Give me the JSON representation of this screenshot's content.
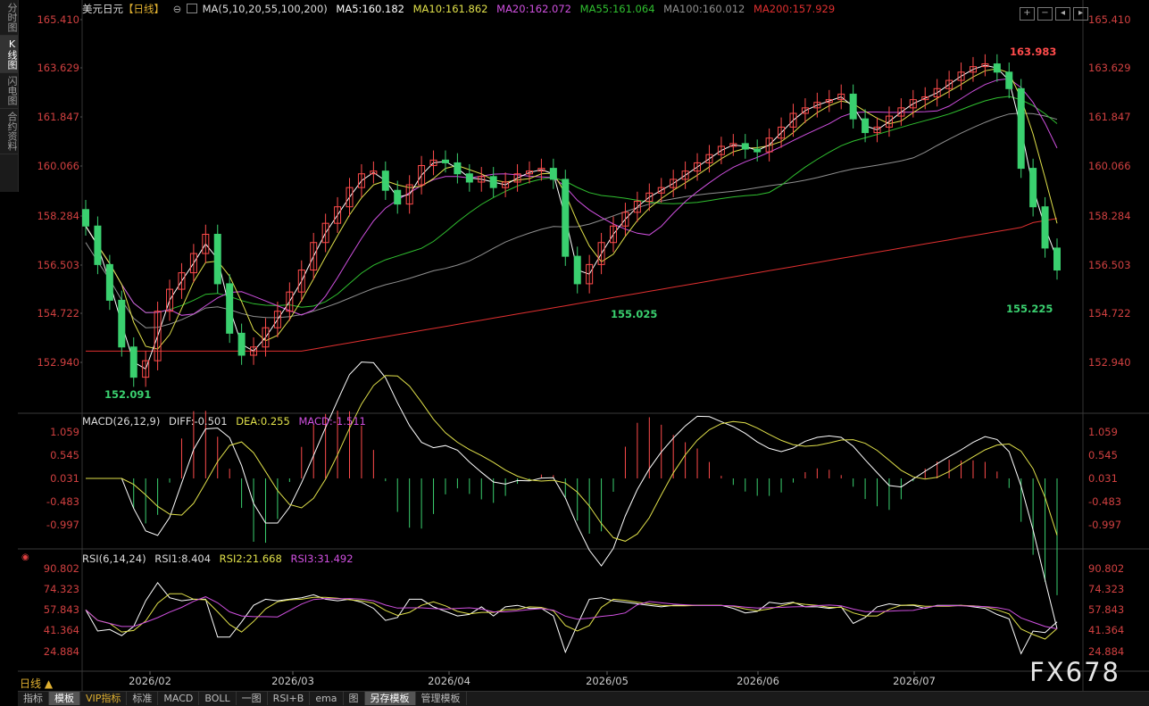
{
  "sidebar": [
    "分时图",
    "K线图",
    "闪电图",
    "合约资料"
  ],
  "main_legend": {
    "symbol": "美元日元",
    "period_tag": "【日线】",
    "ma_label": "MA(5,10,20,55,100,200)",
    "ma5": "MA5:160.182",
    "ma10": "MA10:161.862",
    "ma20": "MA20:162.072",
    "ma55": "MA55:161.064",
    "ma100": "MA100:160.012",
    "ma200": "MA200:157.929"
  },
  "macd_legend": {
    "label": "MACD(26,12,9)",
    "diff": "DIFF:-0.501",
    "dea": "DEA:0.255",
    "macd": "MACD:-1.511"
  },
  "rsi_legend": {
    "label": "RSI(6,14,24)",
    "rsi1": "RSI1:8.404",
    "rsi2": "RSI2:21.668",
    "rsi3": "RSI3:31.492"
  },
  "price_axis": [
    "165.410",
    "163.629",
    "161.847",
    "160.066",
    "158.284",
    "156.503",
    "154.722",
    "152.940"
  ],
  "macd_axis": [
    "1.059",
    "0.545",
    "0.031",
    "-0.483",
    "-0.997"
  ],
  "rsi_axis": [
    "90.802",
    "74.323",
    "57.843",
    "41.364",
    "24.884"
  ],
  "x_labels": [
    "2026/02",
    "2026/03",
    "2026/04",
    "2026/05",
    "2026/06",
    "2026/07"
  ],
  "annotations": {
    "high": "163.983",
    "low1": "152.091",
    "low2": "155.025",
    "low3": "155.225"
  },
  "period_button": "日线 ▲",
  "bottom_tabs": [
    "指标",
    "模板",
    "VIP指标",
    "标准",
    "MACD",
    "BOLL",
    "一图",
    "RSI+B",
    "ema",
    "图",
    "另存模板",
    "管理模板"
  ],
  "watermark": "FX678",
  "colors": {
    "up": "#ff4b4b",
    "down": "#3ad06f",
    "ma5": "#ffffff",
    "ma10": "#e0e04a",
    "ma20": "#d050e0",
    "ma55": "#30c030",
    "ma100": "#909090",
    "ma200": "#e03030",
    "axis": "#d04040"
  },
  "chart_data": {
    "type": "candlestick",
    "x_range": [
      "2026/01",
      "2026/07"
    ],
    "price_range": [
      152.091,
      165.41
    ],
    "close_path": [
      157.9,
      156.5,
      155.2,
      153.5,
      152.4,
      153.0,
      154.8,
      155.6,
      156.2,
      156.9,
      157.6,
      155.8,
      154.0,
      153.2,
      153.5,
      154.2,
      154.8,
      155.5,
      156.3,
      157.3,
      158.0,
      158.6,
      159.3,
      159.8,
      159.9,
      159.2,
      158.7,
      159.4,
      160.1,
      160.3,
      160.2,
      159.8,
      159.5,
      159.7,
      159.3,
      159.5,
      159.8,
      159.9,
      160.0,
      159.6,
      156.8,
      155.8,
      156.5,
      157.3,
      157.9,
      158.4,
      158.8,
      159.1,
      159.3,
      159.6,
      159.9,
      160.2,
      160.5,
      160.8,
      160.9,
      160.7,
      160.6,
      161.1,
      161.5,
      162.0,
      162.2,
      162.4,
      162.5,
      162.7,
      161.8,
      161.3,
      161.5,
      161.9,
      162.2,
      162.5,
      162.6,
      162.9,
      163.2,
      163.5,
      163.7,
      163.8,
      163.5,
      162.9,
      160.0,
      158.6,
      157.1,
      156.3
    ]
  }
}
